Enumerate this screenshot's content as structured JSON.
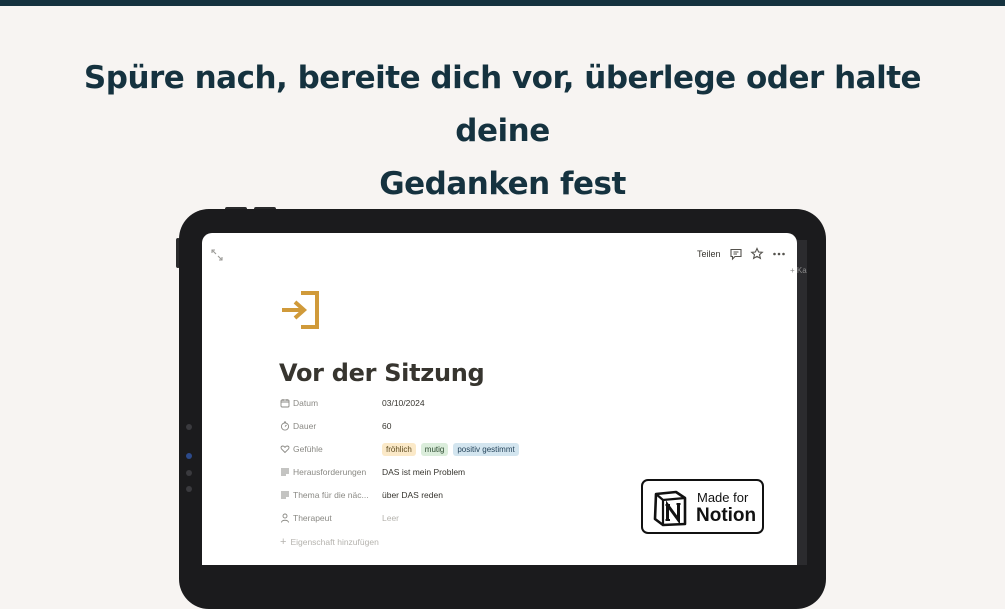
{
  "headline": {
    "line1": "Spüre nach, bereite dich vor, überlege oder halte deine",
    "line2": "Gedanken fest"
  },
  "toolbar": {
    "share_label": "Teilen",
    "icons": [
      "expand-icon",
      "comment-icon",
      "star-icon",
      "more-icon"
    ]
  },
  "screen_edge_text": "+ Ka",
  "page": {
    "icon": "enter-arrow-icon",
    "title": "Vor der Sitzung",
    "properties": [
      {
        "key": "Datum",
        "icon": "calendar-icon",
        "value": "03/10/2024"
      },
      {
        "key": "Dauer",
        "icon": "timer-icon",
        "value": "60"
      },
      {
        "key": "Gefühle",
        "icon": "heart-icon",
        "tags": [
          {
            "label": "fröhlich",
            "bg": "#fbe9c8",
            "fg": "#5c4a1e"
          },
          {
            "label": "mutig",
            "bg": "#dbeddb",
            "fg": "#2b4a2f"
          },
          {
            "label": "positiv gestimmt",
            "bg": "#d3e5ef",
            "fg": "#1f3f56"
          }
        ]
      },
      {
        "key": "Herausforderungen",
        "icon": "text-lines-icon",
        "value": "DAS ist mein Problem"
      },
      {
        "key": "Thema für die näc...",
        "icon": "text-lines-icon",
        "value": "über DAS reden"
      },
      {
        "key": "Therapeut",
        "icon": "person-icon",
        "value": "Leer"
      }
    ],
    "add_property_label": "Eigenschaft hinzufügen"
  },
  "badge": {
    "line1": "Made for",
    "line2": "Notion",
    "logo": "notion-logo-icon"
  },
  "colors": {
    "background": "#f7f4f2",
    "headline": "#15323f",
    "accent_icon": "#d09a3a",
    "tablet_frame": "#1b1b1d"
  }
}
